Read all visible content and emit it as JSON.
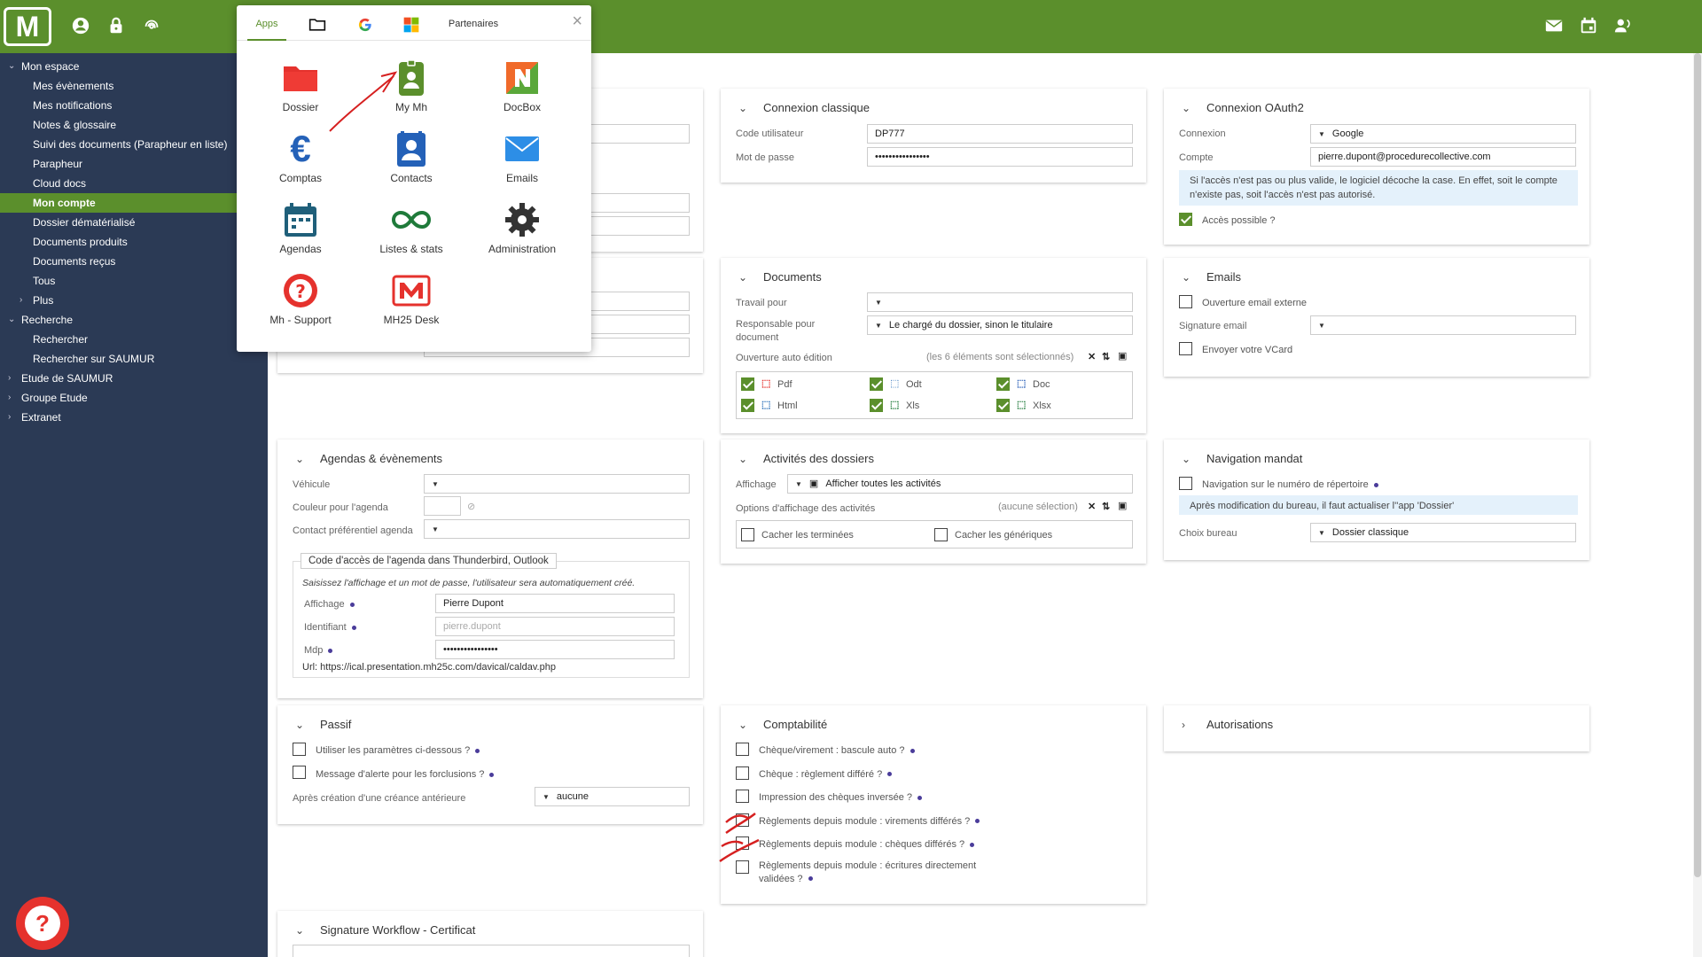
{
  "topbar": {
    "logo_text": "M"
  },
  "sidebar": {
    "items": [
      {
        "label": "Mon espace",
        "level": 0,
        "chev": "⌄"
      },
      {
        "label": "Mes évènements",
        "level": 1
      },
      {
        "label": "Mes notifications",
        "level": 1
      },
      {
        "label": "Notes & glossaire",
        "level": 1
      },
      {
        "label": "Suivi des documents (Parapheur en liste)",
        "level": 1
      },
      {
        "label": "Parapheur",
        "level": 1
      },
      {
        "label": "Cloud docs",
        "level": 1
      },
      {
        "label": "Mon compte",
        "level": 1,
        "active": true
      },
      {
        "label": "Dossier dématérialisé",
        "level": 1
      },
      {
        "label": "Documents produits",
        "level": 1
      },
      {
        "label": "Documents reçus",
        "level": 1
      },
      {
        "label": "Tous",
        "level": 1
      },
      {
        "label": "Plus",
        "level": 1,
        "chev": "›"
      },
      {
        "label": "Recherche",
        "level": 0,
        "chev": "⌄"
      },
      {
        "label": "Rechercher",
        "level": 1
      },
      {
        "label": "Rechercher sur SAUMUR",
        "level": 1
      },
      {
        "label": "Etude de SAUMUR",
        "level": 0,
        "chev": "›"
      },
      {
        "label": "Groupe Etude",
        "level": 0,
        "chev": "›"
      },
      {
        "label": "Extranet",
        "level": 0,
        "chev": "›"
      }
    ]
  },
  "apps_popup": {
    "tabs": {
      "apps": "Apps",
      "partenaires": "Partenaires"
    },
    "close": "×",
    "tiles": {
      "dossier": "Dossier",
      "my_mh": "My Mh",
      "docbox": "DocBox",
      "comptas": "Comptas",
      "contacts": "Contacts",
      "emails": "Emails",
      "agendas": "Agendas",
      "listes": "Listes & stats",
      "administration": "Administration",
      "support": "Mh - Support",
      "desk": "MH25 Desk"
    }
  },
  "connexion_classique": {
    "title": "Connexion classique",
    "code_label": "Code utilisateur",
    "code_value": "DP777",
    "mdp_label": "Mot de passe",
    "mdp_value": "••••••••••••••••"
  },
  "oauth": {
    "title": "Connexion OAuth2",
    "connexion_label": "Connexion",
    "connexion_value": "Google",
    "compte_label": "Compte",
    "compte_value": "pierre.dupont@procedurecollective.com",
    "info": "Si l'accès n'est pas ou plus valide, le logiciel décoche la case. En effet, soit le compte n'existe pas, soit l'accès n'est pas autorisé.",
    "acces_label": "Accès possible ?"
  },
  "documents": {
    "title": "Documents",
    "travail_label": "Travail pour",
    "responsable_label": "Responsable pour document",
    "responsable_value": "Le chargé du dossier, sinon le titulaire",
    "ouverture_label": "Ouverture auto édition",
    "ouverture_note": "(les 6 éléments sont sélectionnés)",
    "types": {
      "pdf": "Pdf",
      "odt": "Odt",
      "doc": "Doc",
      "html": "Html",
      "xls": "Xls",
      "xlsx": "Xlsx"
    }
  },
  "emails": {
    "title": "Emails",
    "ouverture_label": "Ouverture email externe",
    "signature_label": "Signature email",
    "vcard_label": "Envoyer votre VCard"
  },
  "agendas": {
    "title": "Agendas & évènements",
    "vehicule_label": "Véhicule",
    "couleur_label": "Couleur pour l'agenda",
    "contact_label": "Contact préférentiel agenda",
    "code_acces_legend": "Code d'accès de l'agenda dans Thunderbird, Outlook",
    "hint": "Saisissez l'affichage et un mot de passe, l'utilisateur sera automatiquement créé.",
    "affichage_label": "Affichage",
    "affichage_value": "Pierre Dupont",
    "identifiant_label": "Identifiant",
    "identifiant_placeholder": "pierre.dupont",
    "mdp_label": "Mdp",
    "mdp_value": "••••••••••••••••",
    "url_text": "Url: https://ical.presentation.mh25c.com/davical/caldav.php"
  },
  "activites": {
    "title": "Activités des dossiers",
    "affichage_label": "Affichage",
    "affichage_value": "Afficher toutes les activités",
    "options_label": "Options d'affichage des activités",
    "options_note": "(aucune sélection)",
    "terminees_label": "Cacher les terminées",
    "generiques_label": "Cacher les génériques"
  },
  "navigation": {
    "title": "Navigation mandat",
    "repertoire_label": "Navigation sur le numéro de répertoire",
    "info": "Après modification du bureau, il faut actualiser l''app 'Dossier'",
    "bureau_label": "Choix bureau",
    "bureau_value": "Dossier classique"
  },
  "passif": {
    "title": "Passif",
    "param_label": "Utiliser les paramètres ci-dessous ?",
    "alerte_label": "Message d'alerte pour les forclusions ?",
    "creance_label": "Après création d'une créance antérieure",
    "creance_value": "aucune"
  },
  "comptabilite": {
    "title": "Comptabilité",
    "items": [
      "Chèque/virement : bascule auto ?",
      "Chèque : règlement différé ?",
      "Impression des chèques inversée ?",
      "Règlements depuis module : virements différés ?",
      "Règlements depuis module : chèques différés ?",
      "Règlements depuis module : écritures directement validées ?"
    ]
  },
  "autorisations": {
    "title": "Autorisations"
  },
  "signature": {
    "title": "Signature Workflow - Certificat"
  },
  "colors": {
    "brand": "#5b8f2c",
    "sidebar": "#2b3a55",
    "annotation": "#d62020"
  }
}
